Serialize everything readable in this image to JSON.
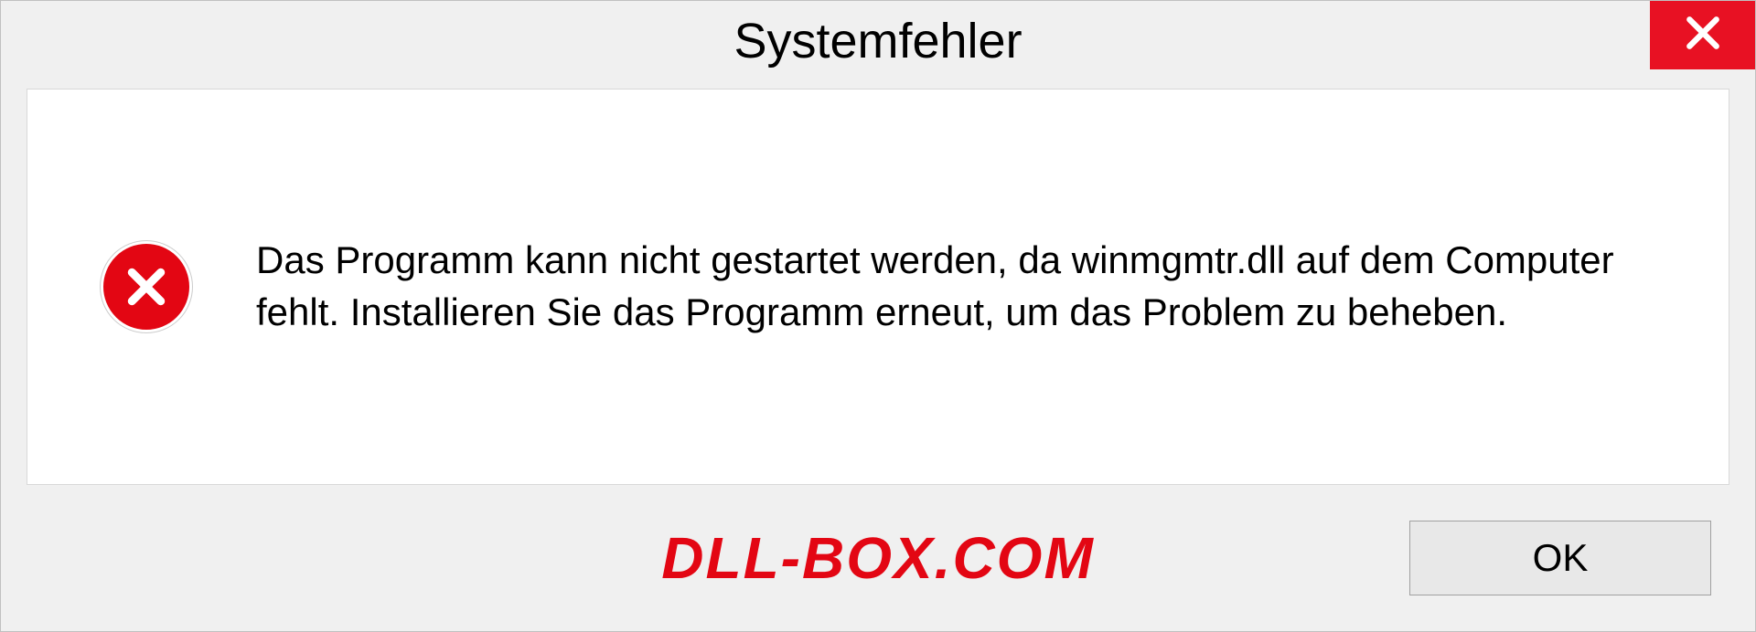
{
  "dialog": {
    "title": "Systemfehler",
    "message": "Das Programm kann nicht gestartet werden, da winmgmtr.dll auf dem Computer fehlt. Installieren Sie das Programm erneut, um das Problem zu beheben.",
    "ok_label": "OK",
    "watermark": "DLL-BOX.COM"
  },
  "icons": {
    "close": "close-icon",
    "error": "error-icon"
  },
  "colors": {
    "close_bg": "#e81123",
    "error_red": "#e30613",
    "dialog_bg": "#f0f0f0",
    "content_bg": "#ffffff"
  }
}
